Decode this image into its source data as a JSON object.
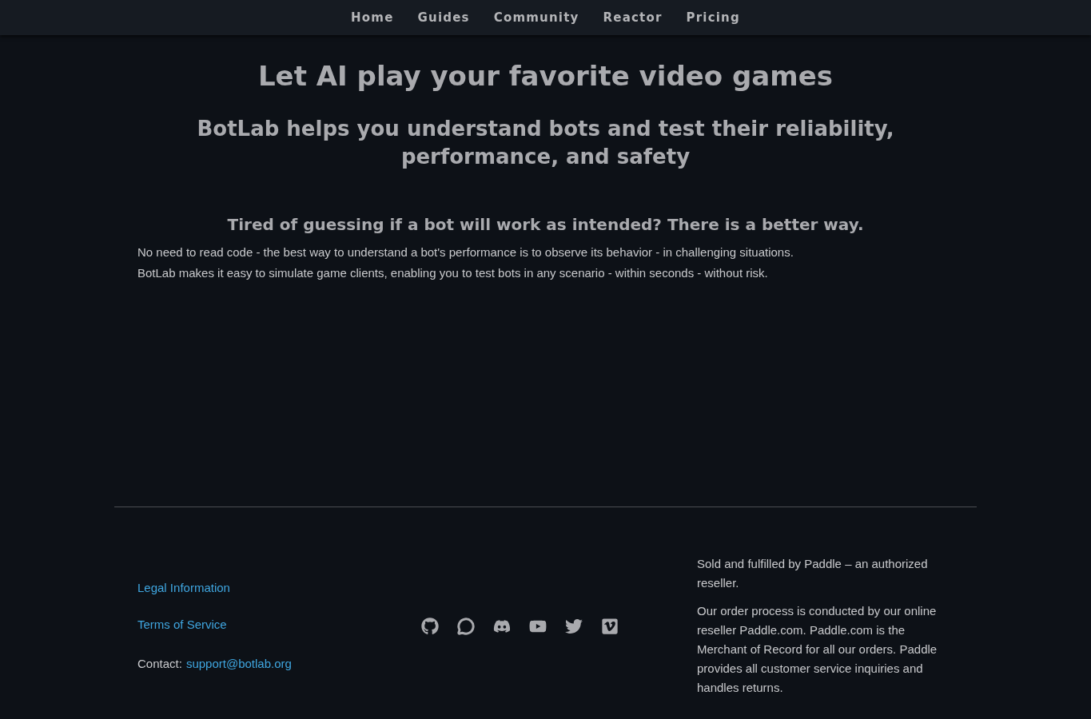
{
  "nav": {
    "links": [
      "Home",
      "Guides",
      "Community",
      "Reactor",
      "Pricing"
    ]
  },
  "hero": {
    "title": "Let AI play your favorite video games",
    "subtitle": "BotLab helps you understand bots and test their reliability, performance, and safety"
  },
  "intro": {
    "heading": "Tired of guessing if a bot will work as intended? There is a better way.",
    "paragraphs": [
      "No need to read code - the best way to understand a bot's performance is to observe its behavior - in challenging situations.",
      "BotLab makes it easy to simulate game clients, enabling you to test bots in any scenario - within seconds - without risk."
    ]
  },
  "footer": {
    "links": [
      "Legal Information",
      "Terms of Service"
    ],
    "contact": {
      "label": "Contact:",
      "email": "support@botlab.org"
    },
    "notice": [
      "Sold and fulfilled by Paddle – an authorized reseller.",
      "Our order process is conducted by our online reseller Paddle.com. Paddle.com is the Merchant of Record for all our orders. Paddle provides all customer service inquiries and handles returns."
    ]
  }
}
